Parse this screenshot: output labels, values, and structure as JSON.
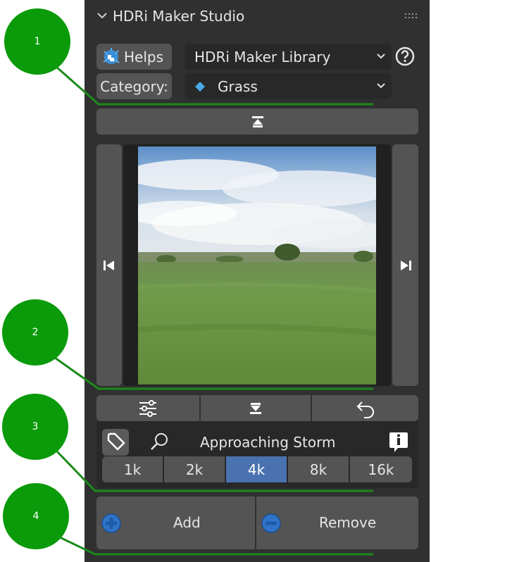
{
  "panel": {
    "title": "HDRi Maker Studio",
    "helps_label": "Helps",
    "library_value": "HDRi Maker Library",
    "category_label": "Category:",
    "category_value": "Grass",
    "asset_name": "Approaching Storm",
    "resolutions": [
      "1k",
      "2k",
      "4k",
      "8k",
      "16k"
    ],
    "selected_resolution": "4k",
    "add_label": "Add",
    "remove_label": "Remove"
  },
  "callouts": [
    "1",
    "2",
    "3",
    "4"
  ],
  "colors": {
    "panel_bg": "#303030",
    "button_bg": "#545454",
    "dropdown_bg": "#282828",
    "selected": "#4a72b0",
    "callout_green": "#0a9a0a",
    "leader_line": "#1a8a1a"
  },
  "icons": [
    "chevron-down-icon",
    "drag-grip-icon",
    "helps-logo-icon",
    "help-icon",
    "diamond-icon",
    "collapse-top-icon",
    "prev-icon",
    "next-icon",
    "sliders-icon",
    "expand-bottom-icon",
    "undo-icon",
    "tag-icon",
    "search-icon",
    "info-icon",
    "add-icon",
    "remove-icon"
  ]
}
